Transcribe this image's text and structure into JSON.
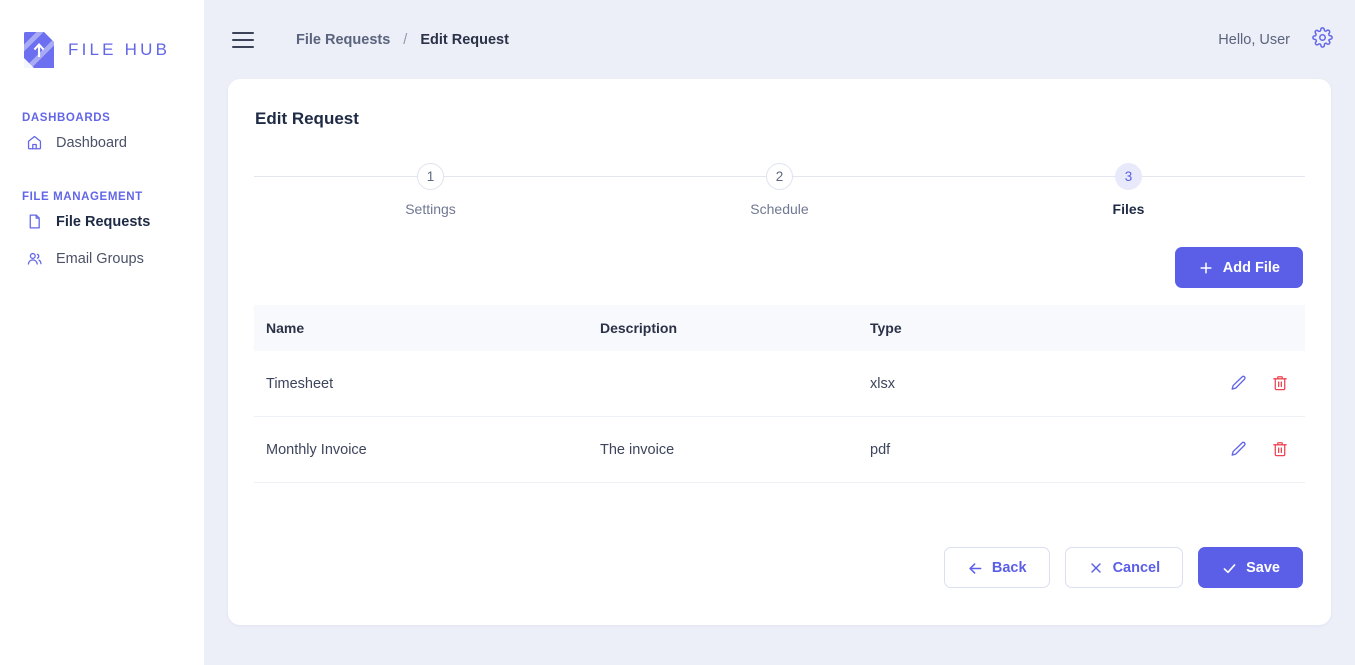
{
  "brand": {
    "name": "FILE HUB",
    "logo_icon": "file-upload-logo-icon"
  },
  "sidebar": {
    "sections": [
      {
        "title": "DASHBOARDS",
        "items": [
          {
            "label": "Dashboard",
            "icon": "home-icon",
            "active": false
          }
        ]
      },
      {
        "title": "FILE MANAGEMENT",
        "items": [
          {
            "label": "File Requests",
            "icon": "file-icon",
            "active": true
          },
          {
            "label": "Email Groups",
            "icon": "users-icon",
            "active": false
          }
        ]
      }
    ]
  },
  "topbar": {
    "menu_icon": "hamburger-menu-icon",
    "breadcrumb": {
      "parent": "File Requests",
      "separator": "/",
      "current": "Edit Request"
    },
    "greeting": "Hello, User",
    "settings_icon": "gear-icon"
  },
  "card": {
    "title": "Edit Request",
    "stepper": [
      {
        "number": "1",
        "label": "Settings",
        "active": false
      },
      {
        "number": "2",
        "label": "Schedule",
        "active": false
      },
      {
        "number": "3",
        "label": "Files",
        "active": true
      }
    ],
    "add_button": {
      "label": "Add File",
      "icon": "plus-icon"
    },
    "table": {
      "columns": [
        "Name",
        "Description",
        "Type"
      ],
      "rows": [
        {
          "name": "Timesheet",
          "description": "",
          "type": "xlsx",
          "edit_icon": "pencil-icon",
          "delete_icon": "trash-icon"
        },
        {
          "name": "Monthly Invoice",
          "description": "The invoice",
          "type": "pdf",
          "edit_icon": "pencil-icon",
          "delete_icon": "trash-icon"
        }
      ]
    },
    "footer": {
      "back": {
        "label": "Back",
        "icon": "arrow-left-icon"
      },
      "cancel": {
        "label": "Cancel",
        "icon": "x-icon"
      },
      "save": {
        "label": "Save",
        "icon": "check-icon"
      }
    }
  },
  "colors": {
    "accent": "#5b5fe8",
    "accent_soft": "#e8e9fb",
    "danger": "#ef4452",
    "page_bg": "#eceef8",
    "text_dark": "#1f2a44",
    "text_muted": "#6f7890"
  }
}
